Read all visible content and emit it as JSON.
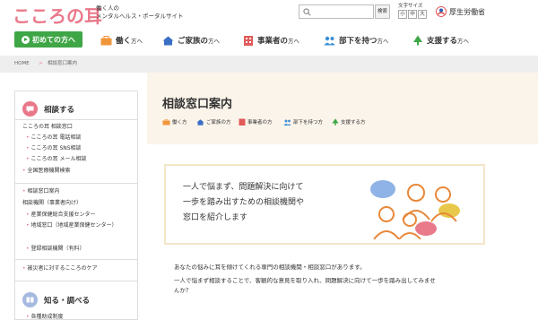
{
  "header": {
    "logo": "こころの耳",
    "tagline_line1": "働く人の",
    "tagline_line2": "メンタルヘルス・ポータルサイト",
    "search_button": "検索",
    "fontsize_label": "文字サイズ",
    "fontsize_small": "小",
    "fontsize_medium": "中",
    "fontsize_large": "大",
    "ministry": "厚生労働省"
  },
  "nav": {
    "first_label": "初めての方へ",
    "items": [
      {
        "main": "働く",
        "sub": "方へ"
      },
      {
        "main": "ご家族の",
        "sub": "方へ"
      },
      {
        "main": "事業者の",
        "sub": "方へ"
      },
      {
        "main": "部下を持つ",
        "sub": "方へ"
      },
      {
        "main": "支援する",
        "sub": "方へ"
      }
    ]
  },
  "breadcrumb": {
    "home": "HOME",
    "sep": ">",
    "current": "相談窓口案内"
  },
  "sidebar": {
    "section1_title": "相談する",
    "section1_group": "こころの耳 相談窓口",
    "section1_links": [
      "こころの耳 電話相談",
      "こころの耳 SNS相談",
      "こころの耳 メール相談",
      "全国医療機関検索"
    ],
    "guide": "相談窓口案内",
    "group2": "相談機関（事業者向け）",
    "group2_links": [
      "産業保健総合支援センター",
      "地域窓口（地域産業保健センター）",
      "登録相談機関（有料）"
    ],
    "disaster": "被災者に対するこころのケア",
    "section2_title": "知る・調べる",
    "section2_link": "各種助成制度"
  },
  "main": {
    "title": "相談窓口案内",
    "categories": [
      "働く方",
      "ご家族の方",
      "事業者の方",
      "部下を持つ方",
      "支援する方"
    ],
    "intro_line1": "一人で悩まず、問題解決に向けて",
    "intro_line2": "一歩を踏み出すための相談機関や",
    "intro_line3": "窓口を紹介します",
    "body_line1": "あなたの悩みに耳を傾けてくれる専門の相談機関・相談窓口があります。",
    "body_line2": "一人で悩まず相談することで、客観的な意見を取り入れ、問題解決に向けて一歩を踏み出してみませ",
    "body_line3": "んか？"
  },
  "colors": {
    "brand_pink": "#e9788a",
    "brand_green": "#3fa646",
    "title_band": "#fbf4ea"
  }
}
